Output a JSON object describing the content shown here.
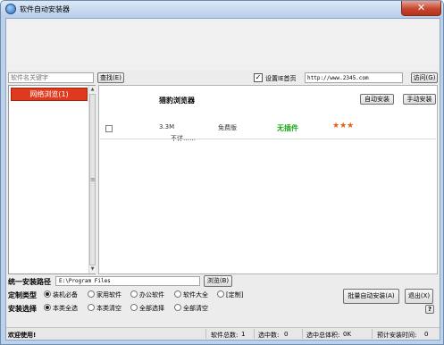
{
  "window": {
    "title": "软件自动安装器",
    "close_glyph": "✕"
  },
  "search": {
    "placeholder": "软件名关键字",
    "button_label": "查找(E)"
  },
  "homepage": {
    "checked": true,
    "check_glyph": "✓",
    "label": "设置IE首页",
    "url": "http://www.2345.com",
    "visit_label": "访问(G)"
  },
  "categories": [
    {
      "label": "网络浏览(1)"
    }
  ],
  "software_list": [
    {
      "name": "猎豹浏览器",
      "size": "3.3M",
      "license": "免费版",
      "plugin": "无插件",
      "rating_stars": "★★★",
      "rating": 3,
      "description": "不详……",
      "auto_install_label": "自动安装",
      "manual_install_label": "手动安装"
    }
  ],
  "install_path": {
    "label": "统一安装路径",
    "value": "E:\\Program Files",
    "browse_label": "浏览(B)"
  },
  "custom_type": {
    "label": "定制类型",
    "options": [
      "装机必备",
      "家用软件",
      "办公软件",
      "软件大全",
      "[定制]"
    ],
    "selected": 0
  },
  "install_select": {
    "label": "安装选择",
    "options": [
      "本类全选",
      "本类清空",
      "全部选择",
      "全部清空"
    ],
    "selected": 0
  },
  "actions": {
    "batch_install_label": "批量自动安装(A)",
    "exit_label": "退出(X)",
    "help_label": "?"
  },
  "status": {
    "welcome": "欢迎使用!",
    "total_label": "软件总数:",
    "total": "1",
    "selected_label": "选中数:",
    "selected": "0",
    "size_label": "选中总体积:",
    "size": "0K",
    "time_label": "预计安装时间:",
    "time": "0"
  },
  "scrollbar": {
    "up_glyph": "▲",
    "down_glyph": "▼",
    "grip_glyph": "≡"
  },
  "colors": {
    "category_active": "#e03a1e",
    "plugin_ok": "#1aa81a",
    "stars": "#e35f16"
  }
}
